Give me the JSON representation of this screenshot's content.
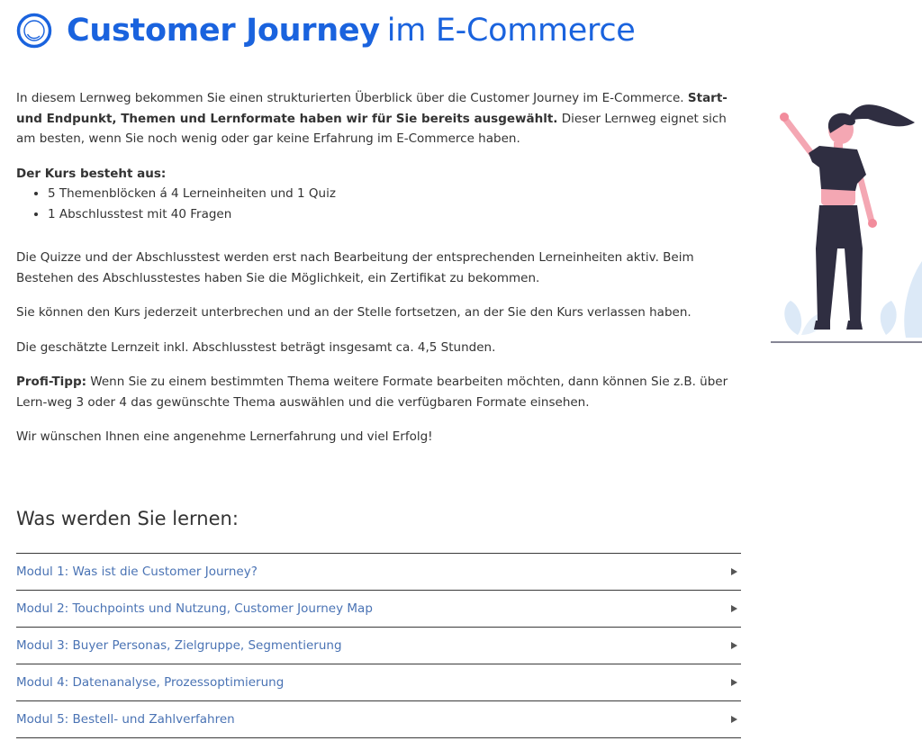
{
  "header": {
    "title_bold": "Customer Journey",
    "title_light": "im E-Commerce"
  },
  "intro": {
    "text_1": "In diesem Lernweg bekommen Sie einen strukturierten Überblick über die Customer Journey im E-Commerce. ",
    "text_bold": "Start- und Endpunkt, Themen und Lernformate haben wir für Sie bereits ausgewählt.",
    "text_2": " Dieser Lernweg eignet sich am besten, wenn Sie noch wenig oder gar keine Erfahrung im E-Commerce haben."
  },
  "course": {
    "heading": "Der Kurs besteht aus:",
    "items": [
      "5 Themenblöcken á 4 Lerneinheiten und 1 Quiz",
      "1 Abschlusstest mit 40 Fragen"
    ]
  },
  "paragraphs": {
    "quiz": "Die Quizze und der Abschlusstest werden erst nach Bearbeitung der entsprechenden Lerneinheiten aktiv. Beim Bestehen des Abschlusstestes haben Sie die Möglichkeit, ein Zertifikat zu bekommen.",
    "pause": "Sie können den Kurs jederzeit unterbrechen und an der Stelle fortsetzen, an der Sie den Kurs verlassen haben.",
    "time": "Die geschätzte Lernzeit inkl. Abschlusstest beträgt insgesamt ca. 4,5 Stunden.",
    "tip_label": "Profi-Tipp:",
    "tip_text": " Wenn Sie zu einem bestimmten Thema weitere Formate bearbeiten möchten, dann können Sie z.B. über Lern-weg 3 oder 4 das gewünschte Thema auswählen und die verfügbaren Formate einsehen.",
    "wish": "Wir wünschen Ihnen eine angenehme Lernerfahrung und viel Erfolg!"
  },
  "learn": {
    "heading": "Was werden Sie lernen:",
    "modules": [
      "Modul 1: Was ist die Customer Journey?",
      "Modul 2: Touchpoints und Nutzung, Customer Journey Map",
      "Modul 3: Buyer Personas, Zielgruppe, Segmentierung",
      "Modul 4: Datenanalyse, Prozessoptimierung",
      "Modul 5: Bestell- und Zahlverfahren"
    ]
  },
  "icons": {
    "logo": "circle-logo-icon",
    "module_arrow": "triangle-right-icon",
    "illustration": "woman-waving-illustration"
  },
  "colors": {
    "brand_blue": "#1a63de",
    "module_link": "#4a73b4",
    "text": "#333333",
    "divider": "#3a3a3a",
    "accent_pink": "#f28c9c",
    "leaf_blue": "#dce9f7"
  }
}
